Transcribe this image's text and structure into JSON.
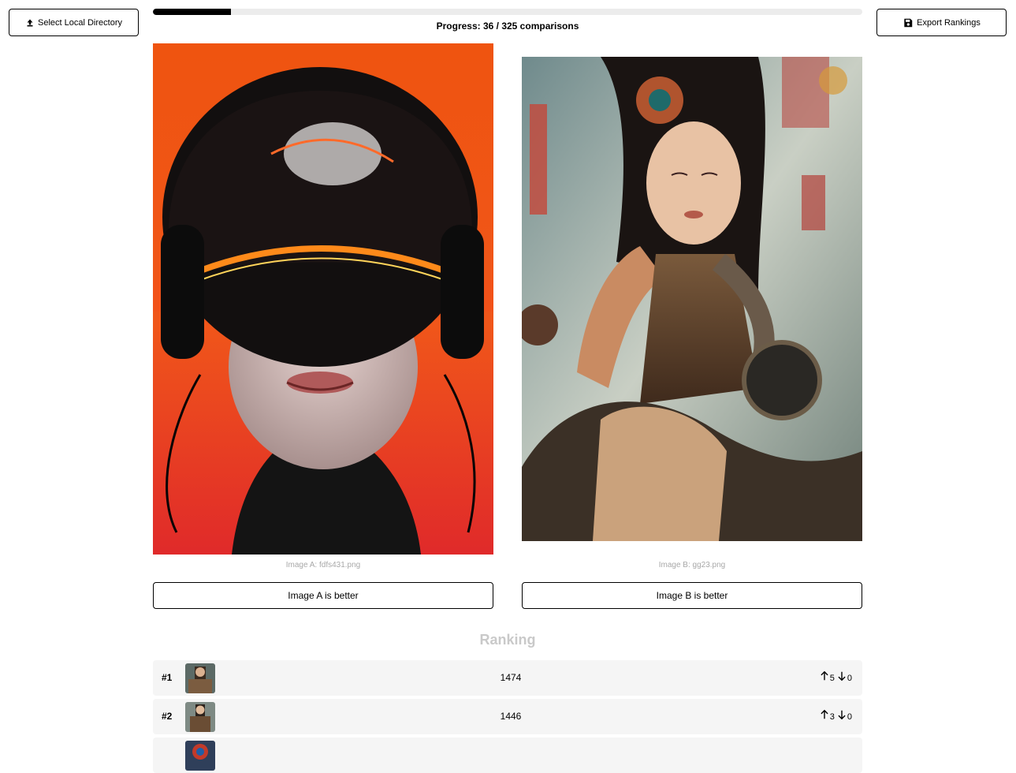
{
  "toolbar": {
    "select_label": "Select Local Directory",
    "export_label": "Export Rankings"
  },
  "progress": {
    "text": "Progress: 36 / 325 comparisons",
    "fraction": 0.11
  },
  "images": {
    "a": {
      "caption": "Image A: fdfs431.png",
      "vote_label": "Image A is better"
    },
    "b": {
      "caption": "Image B: gg23.png",
      "vote_label": "Image B is better"
    }
  },
  "ranking": {
    "title": "Ranking",
    "rows": [
      {
        "rank": "#1",
        "score": "1474",
        "up": "5",
        "down": "0"
      },
      {
        "rank": "#2",
        "score": "1446",
        "up": "3",
        "down": "0"
      }
    ]
  },
  "icons": {
    "select": "upload-icon",
    "export": "save-icon",
    "up": "arrow-up-icon",
    "down": "arrow-down-icon"
  }
}
